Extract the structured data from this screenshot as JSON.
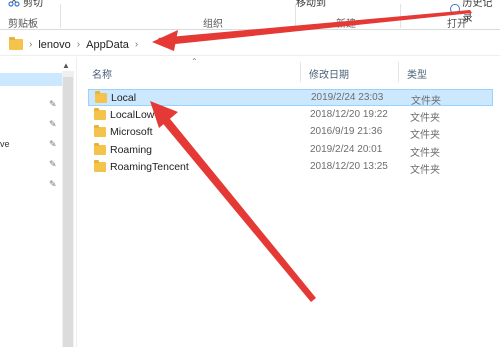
{
  "ribbon": {
    "cut_label": "剪切",
    "move_label": "移动到",
    "history_label": "历史记录",
    "groups": {
      "clipboard": "剪贴板",
      "organize": "组织",
      "new": "新建",
      "open": "打开"
    }
  },
  "address": {
    "crumbs": [
      "lenovo",
      "AppData"
    ]
  },
  "nav": {
    "fragment": "ve"
  },
  "columns": {
    "name": "名称",
    "date": "修改日期",
    "type": "类型"
  },
  "files": [
    {
      "name": "Local",
      "date": "2019/2/24 23:03",
      "type": "文件夹",
      "selected": true
    },
    {
      "name": "LocalLow",
      "date": "2018/12/20 19:22",
      "type": "文件夹",
      "selected": false
    },
    {
      "name": "Microsoft",
      "date": "2016/9/19 21:36",
      "type": "文件夹",
      "selected": false
    },
    {
      "name": "Roaming",
      "date": "2019/2/24 20:01",
      "type": "文件夹",
      "selected": false
    },
    {
      "name": "RoamingTencent",
      "date": "2018/12/20 13:25",
      "type": "文件夹",
      "selected": false
    }
  ],
  "colors": {
    "selection": "#cce8ff",
    "folder": "#f3c34c",
    "annotation_arrow": "#e53935"
  }
}
